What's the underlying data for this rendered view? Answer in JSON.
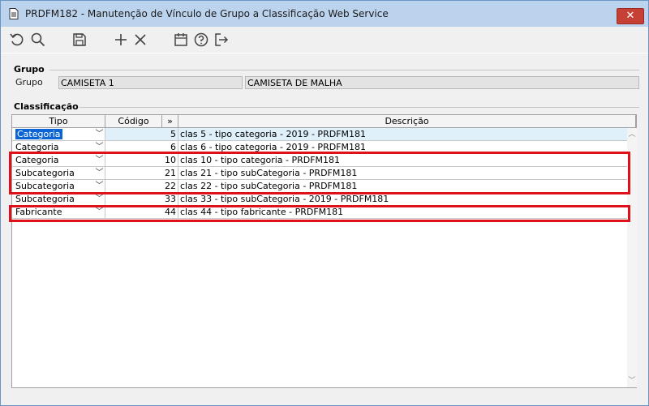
{
  "window": {
    "title": "PRDFM182 - Manutenção de Vínculo de Grupo a Classificação Web Service",
    "close_label": "✕"
  },
  "toolbar": {
    "icons": [
      "undo-icon",
      "search-icon",
      "save-icon",
      "add-icon",
      "delete-icon",
      "calendar-icon",
      "help-icon",
      "exit-icon"
    ]
  },
  "grupo": {
    "section_title": "Grupo",
    "label": "Grupo",
    "code_value": "CAMISETA 1",
    "description_value": "CAMISETA DE MALHA"
  },
  "classificacao": {
    "section_title": "Classificação",
    "columns": {
      "tipo": "Tipo",
      "codigo": "Código",
      "more": "»",
      "descricao": "Descrição"
    },
    "rows": [
      {
        "tipo": "Categoria",
        "codigo": "5",
        "descricao": "clas 5 - tipo categoria - 2019 - PRDFM181"
      },
      {
        "tipo": "Categoria",
        "codigo": "6",
        "descricao": "clas 6 - tipo categoria - 2019 - PRDFM181"
      },
      {
        "tipo": "Categoria",
        "codigo": "10",
        "descricao": "clas 10 - tipo categoria - PRDFM181"
      },
      {
        "tipo": "Subcategoria",
        "codigo": "21",
        "descricao": "clas 21 - tipo subCategoria - PRDFM181"
      },
      {
        "tipo": "Subcategoria",
        "codigo": "22",
        "descricao": "clas 22 - tipo subCategoria - PRDFM181"
      },
      {
        "tipo": "Subcategoria",
        "codigo": "33",
        "descricao": "clas 33 - tipo subCategoria - 2019 - PRDFM181"
      },
      {
        "tipo": "Fabricante",
        "codigo": "44",
        "descricao": "clas 44 - tipo fabricante - PRDFM181"
      }
    ]
  },
  "colors": {
    "highlight_border": "#e0101a",
    "selection": "#0a64d6",
    "titlebar": "#bcd3ee"
  }
}
